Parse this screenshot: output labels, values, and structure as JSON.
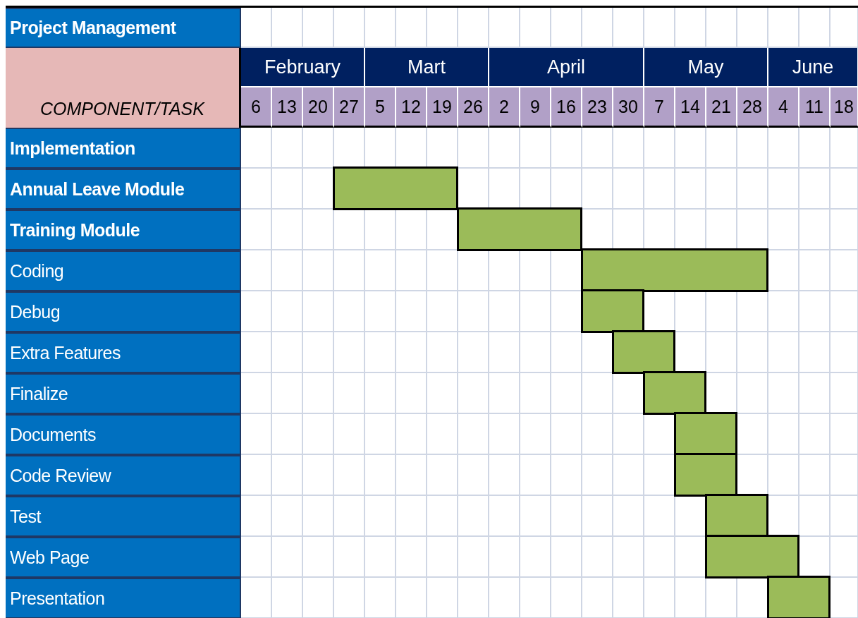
{
  "title": "Project Management",
  "component_header": "COMPONENT/TASK",
  "months": [
    {
      "label": "February",
      "weeks": [
        "6",
        "13",
        "20",
        "27"
      ]
    },
    {
      "label": "Mart",
      "weeks": [
        "5",
        "12",
        "19",
        "26"
      ]
    },
    {
      "label": "April",
      "weeks": [
        "2",
        "9",
        "16",
        "23",
        "30"
      ]
    },
    {
      "label": "May",
      "weeks": [
        "7",
        "14",
        "21",
        "28"
      ]
    },
    {
      "label": "June",
      "weeks": [
        "4",
        "11",
        "18"
      ]
    }
  ],
  "tasks": [
    {
      "name": "Implementation",
      "bold": true,
      "weeks": [
        false,
        false,
        false,
        false,
        false,
        false,
        false,
        false,
        false,
        false,
        false,
        false,
        false,
        false,
        false,
        false,
        false,
        false,
        false,
        false
      ]
    },
    {
      "name": "Annual Leave Module",
      "bold": true,
      "weeks": [
        false,
        false,
        false,
        true,
        true,
        true,
        true,
        false,
        false,
        false,
        false,
        false,
        false,
        false,
        false,
        false,
        false,
        false,
        false,
        false
      ]
    },
    {
      "name": "Training Module",
      "bold": true,
      "weeks": [
        false,
        false,
        false,
        false,
        false,
        false,
        false,
        true,
        true,
        true,
        true,
        false,
        false,
        false,
        false,
        false,
        false,
        false,
        false,
        false
      ]
    },
    {
      "name": "Coding",
      "bold": false,
      "weeks": [
        false,
        false,
        false,
        false,
        false,
        false,
        false,
        false,
        false,
        false,
        false,
        true,
        true,
        true,
        true,
        true,
        true,
        false,
        false,
        false
      ]
    },
    {
      "name": "Debug",
      "bold": false,
      "weeks": [
        false,
        false,
        false,
        false,
        false,
        false,
        false,
        false,
        false,
        false,
        false,
        true,
        true,
        false,
        false,
        false,
        false,
        false,
        false,
        false
      ]
    },
    {
      "name": "Extra Features",
      "bold": false,
      "weeks": [
        false,
        false,
        false,
        false,
        false,
        false,
        false,
        false,
        false,
        false,
        false,
        false,
        true,
        true,
        false,
        false,
        false,
        false,
        false,
        false
      ]
    },
    {
      "name": "Finalize",
      "bold": false,
      "weeks": [
        false,
        false,
        false,
        false,
        false,
        false,
        false,
        false,
        false,
        false,
        false,
        false,
        false,
        true,
        true,
        false,
        false,
        false,
        false,
        false
      ]
    },
    {
      "name": "Documents",
      "bold": false,
      "weeks": [
        false,
        false,
        false,
        false,
        false,
        false,
        false,
        false,
        false,
        false,
        false,
        false,
        false,
        false,
        true,
        true,
        false,
        false,
        false,
        false
      ]
    },
    {
      "name": "Code Review",
      "bold": false,
      "weeks": [
        false,
        false,
        false,
        false,
        false,
        false,
        false,
        false,
        false,
        false,
        false,
        false,
        false,
        false,
        true,
        true,
        false,
        false,
        false,
        false
      ]
    },
    {
      "name": "Test",
      "bold": false,
      "weeks": [
        false,
        false,
        false,
        false,
        false,
        false,
        false,
        false,
        false,
        false,
        false,
        false,
        false,
        false,
        false,
        true,
        true,
        false,
        false,
        false
      ]
    },
    {
      "name": "Web Page",
      "bold": false,
      "weeks": [
        false,
        false,
        false,
        false,
        false,
        false,
        false,
        false,
        false,
        false,
        false,
        false,
        false,
        false,
        false,
        true,
        true,
        true,
        false,
        false
      ]
    },
    {
      "name": "Presentation",
      "bold": false,
      "weeks": [
        false,
        false,
        false,
        false,
        false,
        false,
        false,
        false,
        false,
        false,
        false,
        false,
        false,
        false,
        false,
        false,
        false,
        true,
        true,
        false
      ]
    }
  ]
}
